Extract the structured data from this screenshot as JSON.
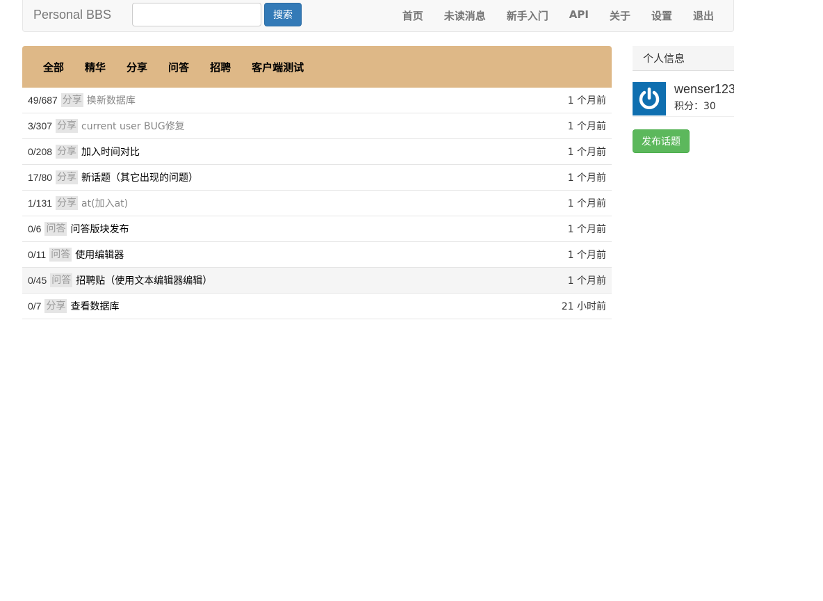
{
  "navbar": {
    "brand": "Personal BBS",
    "search_value": "",
    "search_button": "搜索",
    "links": [
      "首页",
      "未读消息",
      "新手入门",
      "API",
      "关于",
      "设置",
      "退出"
    ]
  },
  "tabs": [
    "全部",
    "精华",
    "分享",
    "问答",
    "招聘",
    "客户端测试"
  ],
  "topics": [
    {
      "count": "49/687",
      "tag": "分享",
      "title": "换新数据库",
      "time": "1 个月前",
      "visited": true
    },
    {
      "count": "3/307",
      "tag": "分享",
      "title": "current user BUG修复",
      "time": "1 个月前",
      "visited": true
    },
    {
      "count": "0/208",
      "tag": "分享",
      "title": "加入时间对比",
      "time": "1 个月前",
      "visited": false
    },
    {
      "count": "17/80",
      "tag": "分享",
      "title": "新话题（其它出现的问题）",
      "time": "1 个月前",
      "visited": false
    },
    {
      "count": "1/131",
      "tag": "分享",
      "title": "at(加入at)",
      "time": "1 个月前",
      "visited": true
    },
    {
      "count": "0/6",
      "tag": "问答",
      "title": "问答版块发布",
      "time": "1 个月前",
      "visited": false
    },
    {
      "count": "0/11",
      "tag": "问答",
      "title": "使用编辑器",
      "time": "1 个月前",
      "visited": false
    },
    {
      "count": "0/45",
      "tag": "问答",
      "title": "招聘贴（使用文本编辑器编辑）",
      "time": "1 个月前",
      "visited": false
    },
    {
      "count": "0/7",
      "tag": "分享",
      "title": "查看数据库",
      "time": "21 小时前",
      "visited": false
    }
  ],
  "sidebar": {
    "header": "个人信息",
    "username": "wenser123",
    "score": "积分：30",
    "publish_button": "发布话题"
  },
  "colors": {
    "tab_bar": "#deb887",
    "primary": "#337ab7",
    "success": "#5cb85c",
    "avatar": "#0f6fb0"
  }
}
